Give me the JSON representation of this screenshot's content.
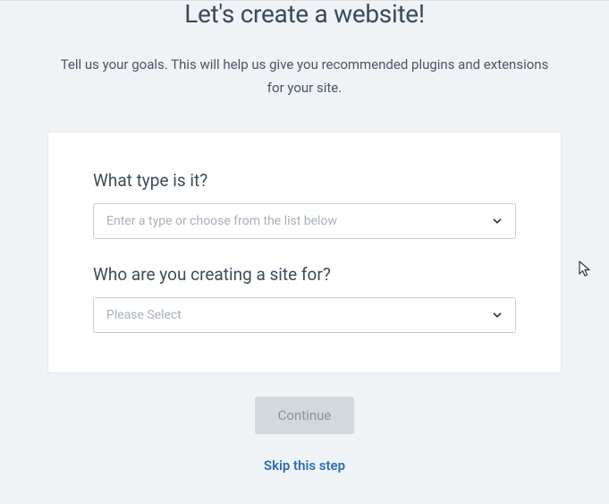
{
  "header": {
    "title": "Let's create a website!",
    "subtitle": "Tell us your goals. This will help us give you recommended plugins and extensions for your site."
  },
  "form": {
    "type_field": {
      "label": "What type is it?",
      "placeholder": "Enter a type or choose from the list below",
      "value": ""
    },
    "audience_field": {
      "label": "Who are you creating a site for?",
      "placeholder": "Please Select",
      "value": ""
    }
  },
  "actions": {
    "continue_label": "Continue",
    "skip_label": "Skip this step"
  }
}
